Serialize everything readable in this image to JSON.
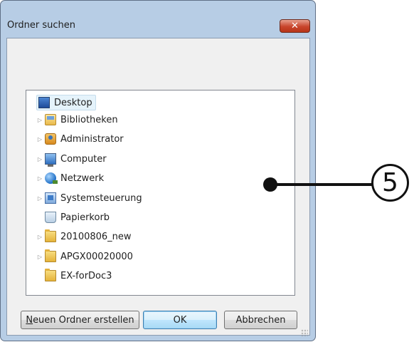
{
  "dialog": {
    "title": "Ordner suchen",
    "close_glyph": "✕"
  },
  "tree": {
    "items": [
      {
        "label": "Desktop",
        "icon": "desktop-icon",
        "expandable": false,
        "selected": true
      },
      {
        "label": "Bibliotheken",
        "icon": "libraries-icon",
        "expandable": true
      },
      {
        "label": "Administrator",
        "icon": "user-folder-icon",
        "expandable": true
      },
      {
        "label": "Computer",
        "icon": "computer-icon",
        "expandable": true
      },
      {
        "label": "Netzwerk",
        "icon": "network-icon",
        "expandable": true
      },
      {
        "label": "Systemsteuerung",
        "icon": "control-panel-icon",
        "expandable": true
      },
      {
        "label": "Papierkorb",
        "icon": "recycle-bin-icon",
        "expandable": false
      },
      {
        "label": "20100806_new",
        "icon": "folder-icon",
        "expandable": true
      },
      {
        "label": "APGX00020000",
        "icon": "folder-icon",
        "expandable": true
      },
      {
        "label": "EX-forDoc3",
        "icon": "folder-icon",
        "expandable": false
      }
    ],
    "expand_glyph": "▷"
  },
  "buttons": {
    "new_folder_mnemonic": "N",
    "new_folder_rest": "euen Ordner erstellen",
    "ok": "OK",
    "cancel": "Abbrechen"
  },
  "callout": {
    "number": "5"
  },
  "colors": {
    "frame": "#b7cde5",
    "close": "#c8452c",
    "selection": "#e5f3fb",
    "ok_accent": "#3c7fb1"
  }
}
